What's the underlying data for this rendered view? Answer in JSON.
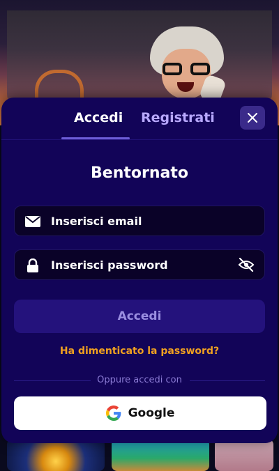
{
  "tabs": {
    "login_label": "Accedi",
    "register_label": "Registrati"
  },
  "modal": {
    "title": "Bentornato",
    "email_placeholder": "Inserisci email",
    "password_placeholder": "Inserisci password",
    "submit_label": "Accedi",
    "forgot_label": "Ha dimenticato la password?",
    "divider_label": "Oppure accedi con",
    "google_label": "Google"
  },
  "icons": {
    "close": "close-icon",
    "email": "envelope-icon",
    "password": "lock-icon",
    "toggle_visibility": "eye-slash-icon",
    "google": "google-logo-icon"
  },
  "colors": {
    "modal_bg": "#120458",
    "accent_link": "#f0a020",
    "inactive_tab": "#b8a8ff",
    "button_bg": "#24127c"
  }
}
